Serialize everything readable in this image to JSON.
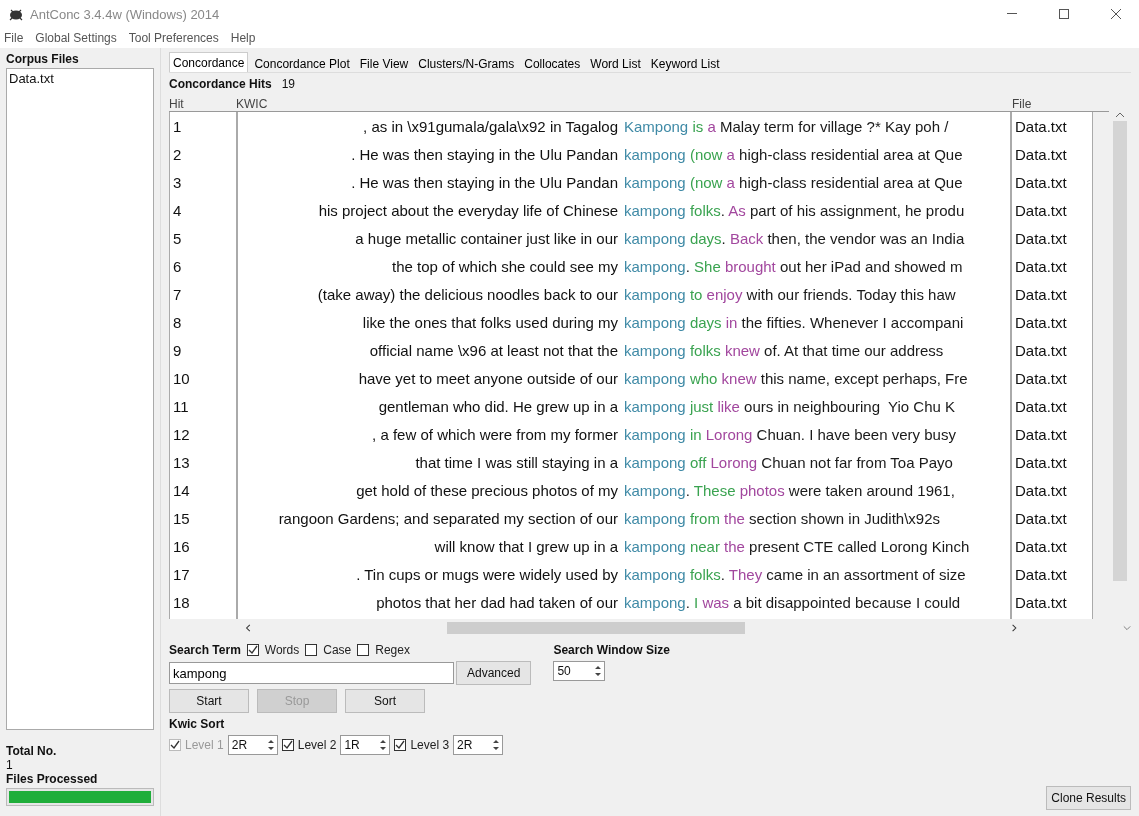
{
  "window": {
    "title": "AntConc 3.4.4w (Windows) 2014"
  },
  "menu": [
    "File",
    "Global Settings",
    "Tool Preferences",
    "Help"
  ],
  "corpus_files": {
    "title": "Corpus Files",
    "items": [
      "Data.txt"
    ]
  },
  "total": {
    "label": "Total No.",
    "value": "1"
  },
  "files_processed": {
    "label": "Files Processed",
    "level": 1
  },
  "tabs": [
    {
      "label": "Concordance",
      "selected": true
    },
    {
      "label": "Concordance Plot",
      "selected": false
    },
    {
      "label": "File View",
      "selected": false
    },
    {
      "label": "Clusters/N-Grams",
      "selected": false
    },
    {
      "label": "Collocates",
      "selected": false
    },
    {
      "label": "Word List",
      "selected": false
    },
    {
      "label": "Keyword List",
      "selected": false
    }
  ],
  "hits": {
    "label": "Concordance Hits",
    "value": "19"
  },
  "table": {
    "columns": [
      "Hit",
      "KWIC",
      "File"
    ],
    "rows": [
      {
        "hit": "1",
        "left": ", as in \\x91gumala/gala\\x92 in Tagalog",
        "right": [
          {
            "kind": "key",
            "text": "Kampong"
          },
          {
            "kind": "r1",
            "text": " is"
          },
          {
            "kind": "r2",
            "text": " a"
          },
          {
            "kind": "plain",
            "text": " Malay term for village ?* Kay poh /"
          }
        ],
        "file": "Data.txt"
      },
      {
        "hit": "2",
        "left": ". He was then staying in the Ulu Pandan",
        "right": [
          {
            "kind": "key",
            "text": "kampong"
          },
          {
            "kind": "r1",
            "text": " (now"
          },
          {
            "kind": "r2",
            "text": " a"
          },
          {
            "kind": "plain",
            "text": " high-class residential area at Que"
          }
        ],
        "file": "Data.txt"
      },
      {
        "hit": "3",
        "left": ". He was then staying in the Ulu Pandan",
        "right": [
          {
            "kind": "key",
            "text": "kampong"
          },
          {
            "kind": "r1",
            "text": " (now"
          },
          {
            "kind": "r2",
            "text": " a"
          },
          {
            "kind": "plain",
            "text": " high-class residential area at Que"
          }
        ],
        "file": "Data.txt"
      },
      {
        "hit": "4",
        "left": "his project about the everyday life of Chinese",
        "right": [
          {
            "kind": "key",
            "text": "kampong"
          },
          {
            "kind": "r1",
            "text": " folks"
          },
          {
            "kind": "plain",
            "text": "."
          },
          {
            "kind": "r2",
            "text": " As"
          },
          {
            "kind": "plain",
            "text": " part of his assignment, he produ"
          }
        ],
        "file": "Data.txt"
      },
      {
        "hit": "5",
        "left": "a huge metallic container just like in our",
        "right": [
          {
            "kind": "key",
            "text": "kampong"
          },
          {
            "kind": "r1",
            "text": " days"
          },
          {
            "kind": "plain",
            "text": "."
          },
          {
            "kind": "r2",
            "text": " Back"
          },
          {
            "kind": "plain",
            "text": " then, the vendor was an India"
          }
        ],
        "file": "Data.txt"
      },
      {
        "hit": "6",
        "left": "the top of which she could see my",
        "right": [
          {
            "kind": "key",
            "text": "kampong"
          },
          {
            "kind": "plain",
            "text": "."
          },
          {
            "kind": "r1",
            "text": " She"
          },
          {
            "kind": "r2",
            "text": " brought"
          },
          {
            "kind": "plain",
            "text": " out her iPad and showed m"
          }
        ],
        "file": "Data.txt"
      },
      {
        "hit": "7",
        "left": "(take away) the delicious noodles back to our",
        "right": [
          {
            "kind": "key",
            "text": "kampong"
          },
          {
            "kind": "r1",
            "text": " to"
          },
          {
            "kind": "r2",
            "text": " enjoy"
          },
          {
            "kind": "plain",
            "text": " with our friends. Today this haw"
          }
        ],
        "file": "Data.txt"
      },
      {
        "hit": "8",
        "left": "like the ones that folks used during my",
        "right": [
          {
            "kind": "key",
            "text": "kampong"
          },
          {
            "kind": "r1",
            "text": " days"
          },
          {
            "kind": "r2",
            "text": " in"
          },
          {
            "kind": "plain",
            "text": " the fifties. Whenever I accompani"
          }
        ],
        "file": "Data.txt"
      },
      {
        "hit": "9",
        "left": "official name \\x96 at least not that the",
        "right": [
          {
            "kind": "key",
            "text": "kampong"
          },
          {
            "kind": "r1",
            "text": " folks"
          },
          {
            "kind": "r2",
            "text": " knew"
          },
          {
            "kind": "plain",
            "text": " of. At that time our address"
          }
        ],
        "file": "Data.txt"
      },
      {
        "hit": "10",
        "left": "have yet to meet anyone outside of our",
        "right": [
          {
            "kind": "key",
            "text": "kampong"
          },
          {
            "kind": "r1",
            "text": " who"
          },
          {
            "kind": "r2",
            "text": " knew"
          },
          {
            "kind": "plain",
            "text": " this name, except perhaps, Fre"
          }
        ],
        "file": "Data.txt"
      },
      {
        "hit": "11",
        "left": "gentleman who did. He grew up in a",
        "right": [
          {
            "kind": "key",
            "text": "kampong"
          },
          {
            "kind": "r1",
            "text": " just"
          },
          {
            "kind": "r2",
            "text": " like"
          },
          {
            "kind": "plain",
            "text": " ours in neighbouring  Yio Chu K"
          }
        ],
        "file": "Data.txt"
      },
      {
        "hit": "12",
        "left": ", a few of which were from my former",
        "right": [
          {
            "kind": "key",
            "text": "kampong"
          },
          {
            "kind": "r1",
            "text": " in"
          },
          {
            "kind": "r2",
            "text": " Lorong"
          },
          {
            "kind": "plain",
            "text": " Chuan. I have been very busy"
          }
        ],
        "file": "Data.txt"
      },
      {
        "hit": "13",
        "left": "that time I was still staying in a",
        "right": [
          {
            "kind": "key",
            "text": "kampong"
          },
          {
            "kind": "r1",
            "text": " off"
          },
          {
            "kind": "r2",
            "text": " Lorong"
          },
          {
            "kind": "plain",
            "text": " Chuan not far from Toa Payo"
          }
        ],
        "file": "Data.txt"
      },
      {
        "hit": "14",
        "left": "get hold of these precious photos of my",
        "right": [
          {
            "kind": "key",
            "text": "kampong"
          },
          {
            "kind": "plain",
            "text": "."
          },
          {
            "kind": "r1",
            "text": " These"
          },
          {
            "kind": "r2",
            "text": " photos"
          },
          {
            "kind": "plain",
            "text": " were taken around 1961,"
          }
        ],
        "file": "Data.txt"
      },
      {
        "hit": "15",
        "left": "rangoon Gardens; and separated my section of our",
        "right": [
          {
            "kind": "key",
            "text": "kampong"
          },
          {
            "kind": "r1",
            "text": " from"
          },
          {
            "kind": "r2",
            "text": " the"
          },
          {
            "kind": "plain",
            "text": " section shown in Judith\\x92s"
          }
        ],
        "file": "Data.txt"
      },
      {
        "hit": "16",
        "left": "will know that I grew up in a",
        "right": [
          {
            "kind": "key",
            "text": "kampong"
          },
          {
            "kind": "r1",
            "text": " near"
          },
          {
            "kind": "r2",
            "text": " the"
          },
          {
            "kind": "plain",
            "text": " present CTE called Lorong Kinch"
          }
        ],
        "file": "Data.txt"
      },
      {
        "hit": "17",
        "left": ". Tin cups or mugs were widely used by",
        "right": [
          {
            "kind": "key",
            "text": "kampong"
          },
          {
            "kind": "r1",
            "text": " folks"
          },
          {
            "kind": "plain",
            "text": "."
          },
          {
            "kind": "r2",
            "text": " They"
          },
          {
            "kind": "plain",
            "text": " came in an assortment of size"
          }
        ],
        "file": "Data.txt"
      },
      {
        "hit": "18",
        "left": "photos that her dad had taken of our",
        "right": [
          {
            "kind": "key",
            "text": "kampong"
          },
          {
            "kind": "plain",
            "text": "."
          },
          {
            "kind": "r1",
            "text": " I"
          },
          {
            "kind": "r2",
            "text": " was"
          },
          {
            "kind": "plain",
            "text": " a bit disappointed because I could"
          }
        ],
        "file": "Data.txt"
      }
    ]
  },
  "search": {
    "label": "Search Term",
    "options": [
      {
        "label": "Words",
        "checked": true
      },
      {
        "label": "Case",
        "checked": false
      },
      {
        "label": "Regex",
        "checked": false
      }
    ],
    "value": "kampong",
    "advanced": "Advanced"
  },
  "window_size": {
    "label": "Search Window Size",
    "value": "50"
  },
  "buttons": [
    {
      "label": "Start",
      "disabled": false
    },
    {
      "label": "Stop",
      "disabled": true
    },
    {
      "label": "Sort",
      "disabled": false
    }
  ],
  "kwic_sort": {
    "label": "Kwic Sort",
    "levels": [
      {
        "label": "Level 1",
        "checked": true,
        "disabled": true,
        "value": "2R"
      },
      {
        "label": "Level 2",
        "checked": true,
        "disabled": false,
        "value": "1R"
      },
      {
        "label": "Level 3",
        "checked": true,
        "disabled": false,
        "value": "2R"
      }
    ]
  },
  "clone": "Clone Results"
}
